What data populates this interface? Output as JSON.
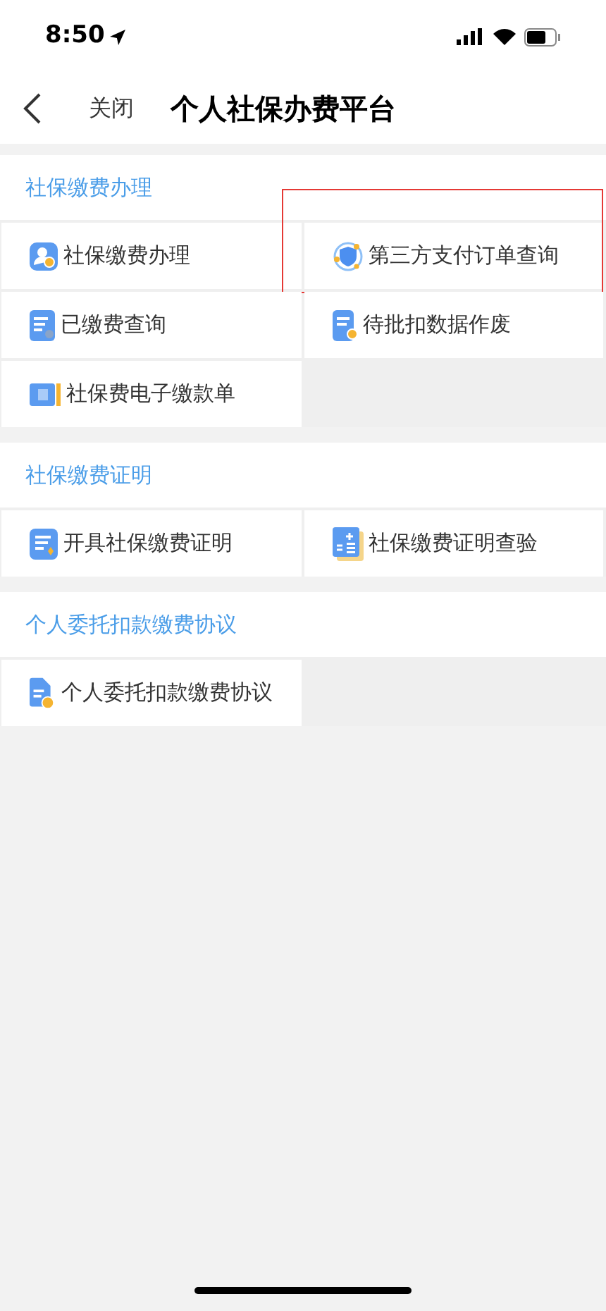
{
  "status_bar": {
    "time": "8:50"
  },
  "nav": {
    "close": "关闭",
    "title": "个人社保办费平台"
  },
  "sections": [
    {
      "title": "社保缴费办理",
      "items": [
        {
          "label": "社保缴费办理",
          "highlighted": false
        },
        {
          "label": "第三方支付订单查询",
          "highlighted": true
        },
        {
          "label": "已缴费查询",
          "highlighted": false
        },
        {
          "label": "待批扣数据作废",
          "highlighted": false
        },
        {
          "label": "社保费电子缴款单",
          "highlighted": false
        }
      ]
    },
    {
      "title": "社保缴费证明",
      "items": [
        {
          "label": "开具社保缴费证明",
          "highlighted": false
        },
        {
          "label": "社保缴费证明查验",
          "highlighted": false
        }
      ]
    },
    {
      "title": "个人委托扣款缴费协议",
      "items": [
        {
          "label": "个人委托扣款缴费协议",
          "highlighted": false
        }
      ]
    }
  ]
}
